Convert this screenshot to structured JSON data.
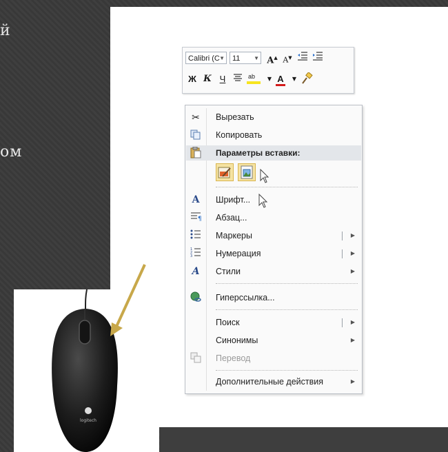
{
  "side_text": {
    "line1": "й",
    "line2": "ом"
  },
  "mini_toolbar": {
    "font_name": "Calibri (С",
    "font_size": "11",
    "grow_font": "A",
    "shrink_font": "A",
    "bold": "Ж",
    "italic": "К",
    "underline": "Ч",
    "highlight_text": "ab",
    "font_color_letter": "A"
  },
  "context_menu": {
    "cut": "Вырезать",
    "copy": "Копировать",
    "paste_options_header": "Параметры вставки:",
    "font": "Шрифт...",
    "paragraph": "Абзац...",
    "bullets": "Маркеры",
    "numbering": "Нумерация",
    "styles": "Стили",
    "hyperlink": "Гиперссылка...",
    "search": "Поиск",
    "synonyms": "Синонимы",
    "translate": "Перевод",
    "additional_actions": "Дополнительные действия"
  },
  "mouse_photo": {
    "brand": "logitech"
  },
  "colors": {
    "highlight_yellow": "#f7e51f",
    "font_red": "#d31b1b",
    "header_bg": "#e3e6ea",
    "arrow_gold": "#c8a84a"
  }
}
